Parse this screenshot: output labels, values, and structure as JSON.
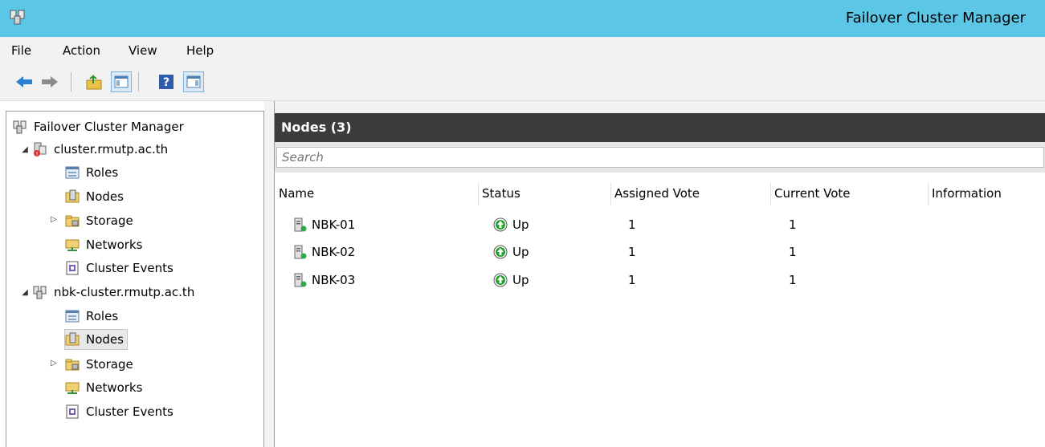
{
  "window": {
    "title": "Failover Cluster Manager"
  },
  "menu": {
    "items": [
      "File",
      "Action",
      "View",
      "Help"
    ]
  },
  "tree": {
    "root": "Failover Cluster Manager",
    "clusters": [
      {
        "name": "cluster.rmutp.ac.th",
        "children": [
          "Roles",
          "Nodes",
          "Storage",
          "Networks",
          "Cluster Events"
        ]
      },
      {
        "name": "nbk-cluster.rmutp.ac.th",
        "children": [
          "Roles",
          "Nodes",
          "Storage",
          "Networks",
          "Cluster Events"
        ],
        "selected_child": "Nodes"
      }
    ]
  },
  "panel": {
    "title": "Nodes (3)",
    "search_placeholder": "Search",
    "columns": [
      "Name",
      "Status",
      "Assigned Vote",
      "Current Vote",
      "Information"
    ],
    "rows": [
      {
        "name": "NBK-01",
        "status": "Up",
        "assigned_vote": "1",
        "current_vote": "1",
        "information": ""
      },
      {
        "name": "NBK-02",
        "status": "Up",
        "assigned_vote": "1",
        "current_vote": "1",
        "information": ""
      },
      {
        "name": "NBK-03",
        "status": "Up",
        "assigned_vote": "1",
        "current_vote": "1",
        "information": ""
      }
    ]
  },
  "colors": {
    "titlebar": "#5cc6e6",
    "header_band": "#3c3c3c",
    "status_up": "#22a42b"
  },
  "icons": [
    "cluster-manager-icon",
    "back-arrow-icon",
    "forward-arrow-icon",
    "up-folder-icon",
    "show-tree-icon",
    "help-icon",
    "action-pane-icon",
    "roles-icon",
    "nodes-icon",
    "storage-icon",
    "networks-icon",
    "cluster-events-icon",
    "server-icon",
    "status-up-icon"
  ]
}
